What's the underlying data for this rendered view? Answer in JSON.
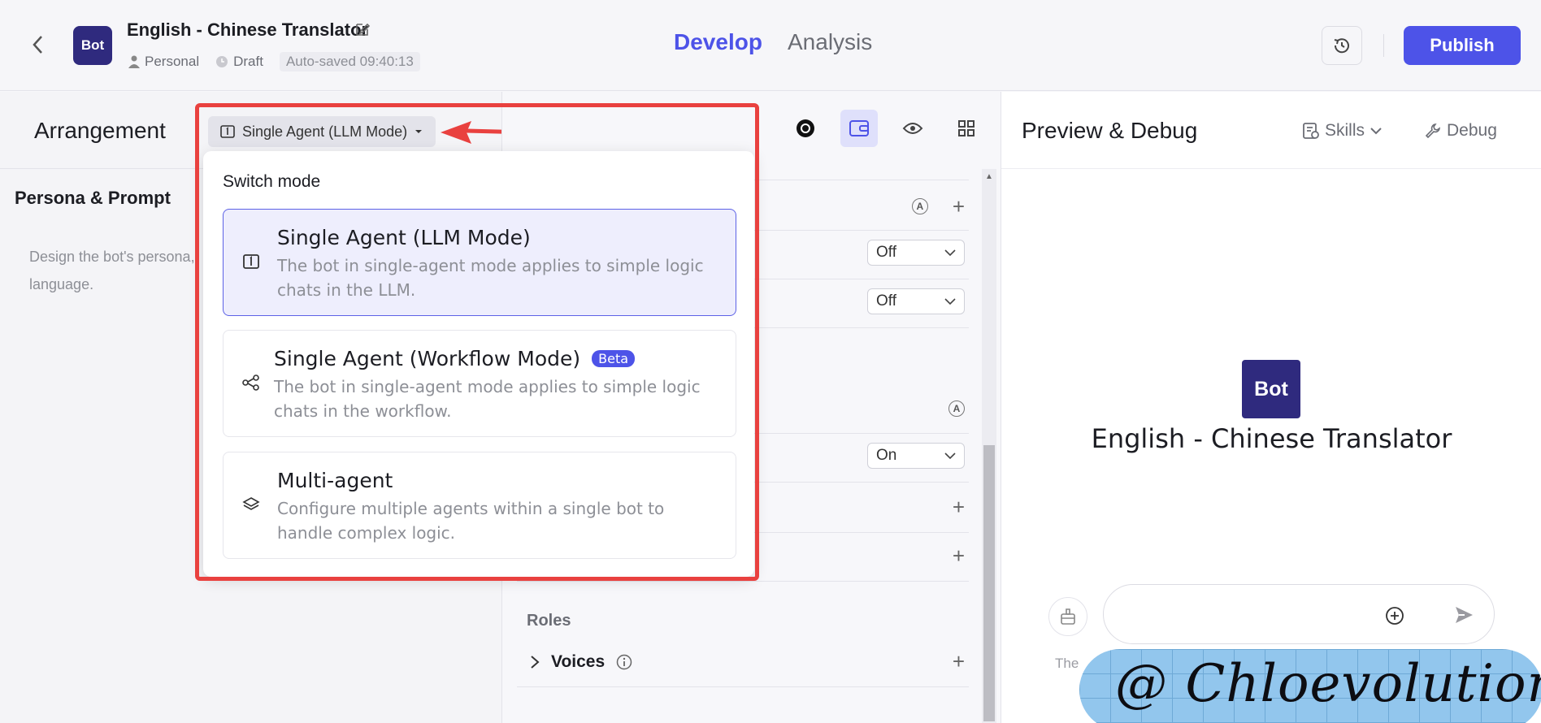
{
  "header": {
    "back_icon": "chevron-left-icon",
    "avatar_text": "Bot",
    "bot_title": "English - Chinese Translator",
    "meta": {
      "personal": "Personal",
      "draft": "Draft",
      "autosaved": "Auto-saved 09:40:13"
    },
    "tabs": {
      "develop": "Develop",
      "analysis": "Analysis"
    },
    "publish_label": "Publish"
  },
  "left": {
    "arrangement_title": "Arrangement",
    "mode_button_label": "Single Agent (LLM Mode)",
    "persona_title": "Persona & Prompt",
    "persona_desc": "Design the bot's persona, language."
  },
  "middle": {
    "selects": [
      "Off",
      "Off",
      "On"
    ],
    "roles_title": "Roles",
    "voices_label": "Voices"
  },
  "dropdown": {
    "switch_label": "Switch mode",
    "options": [
      {
        "title": "Single Agent (LLM Mode)",
        "desc": "The bot in single-agent mode applies to simple logic chats in the LLM.",
        "icon": "single-agent-icon",
        "selected": true
      },
      {
        "title": "Single Agent (Workflow Mode)",
        "badge": "Beta",
        "desc": "The bot in single-agent mode applies to simple logic chats in the workflow.",
        "icon": "workflow-icon",
        "selected": false
      },
      {
        "title": "Multi-agent",
        "desc": "Configure multiple agents within a single bot to handle complex logic.",
        "icon": "layers-icon",
        "selected": false
      }
    ]
  },
  "right": {
    "title": "Preview & Debug",
    "skills_label": "Skills",
    "debug_label": "Debug",
    "bot_avatar_text": "Bot",
    "bot_name": "English - Chinese Translator",
    "disclaimer": "The",
    "watermark": "@ Chloevolution"
  },
  "colors": {
    "accent": "#4d53e8",
    "highlight_frame": "#e9413f"
  }
}
